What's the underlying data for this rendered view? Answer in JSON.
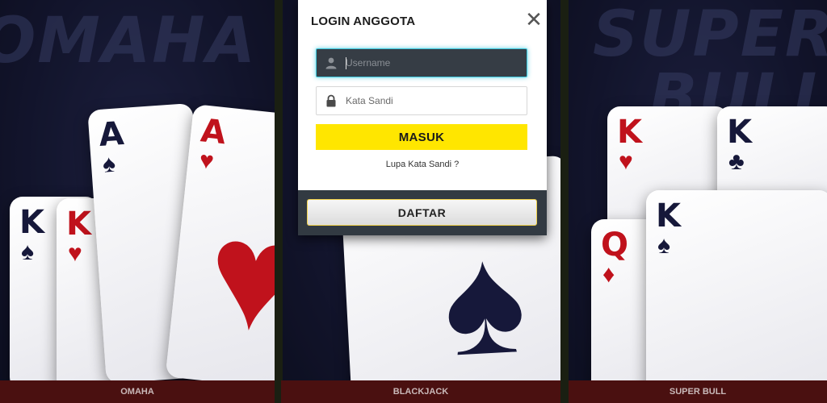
{
  "panels": {
    "omaha": {
      "big_title": "OMAHA",
      "footer_label": "OMAHA"
    },
    "blackjack": {
      "big_title": "",
      "footer_label": "BLACKJACK"
    },
    "superbull": {
      "big_title_line1": "SUPER",
      "big_title_line2": "BULL",
      "footer_label": "SUPER BULL"
    }
  },
  "cards": {
    "omaha": [
      {
        "rank": "K",
        "suit": "♠",
        "color": "black"
      },
      {
        "rank": "K",
        "suit": "♥",
        "color": "red"
      },
      {
        "rank": "A",
        "suit": "♠",
        "color": "black"
      },
      {
        "rank": "A",
        "suit": "♥",
        "color": "red"
      }
    ],
    "blackjack": [
      {
        "rank": "",
        "suit": "♠",
        "color": "black"
      }
    ],
    "superbull": [
      {
        "rank": "K",
        "suit": "♥",
        "color": "red"
      },
      {
        "rank": "K",
        "suit": "♣",
        "color": "black"
      },
      {
        "rank": "Q",
        "suit": "♦",
        "color": "red"
      },
      {
        "rank": "K",
        "suit": "♠",
        "color": "black"
      }
    ]
  },
  "login": {
    "title": "LOGIN ANGGOTA",
    "close_symbol": "✕",
    "username": {
      "value": "",
      "placeholder": "Username",
      "icon": "user-icon"
    },
    "password": {
      "value": "",
      "placeholder": "Kata Sandi",
      "icon": "lock-icon"
    },
    "submit_label": "MASUK",
    "forgot_label": "Lupa Kata Sandi ?",
    "register_label": "DAFTAR"
  },
  "colors": {
    "accent_yellow": "#ffe600",
    "modal_footer": "#323a42",
    "focus_glow": "#3ec8dd",
    "panel_footer": "#4a1010"
  }
}
